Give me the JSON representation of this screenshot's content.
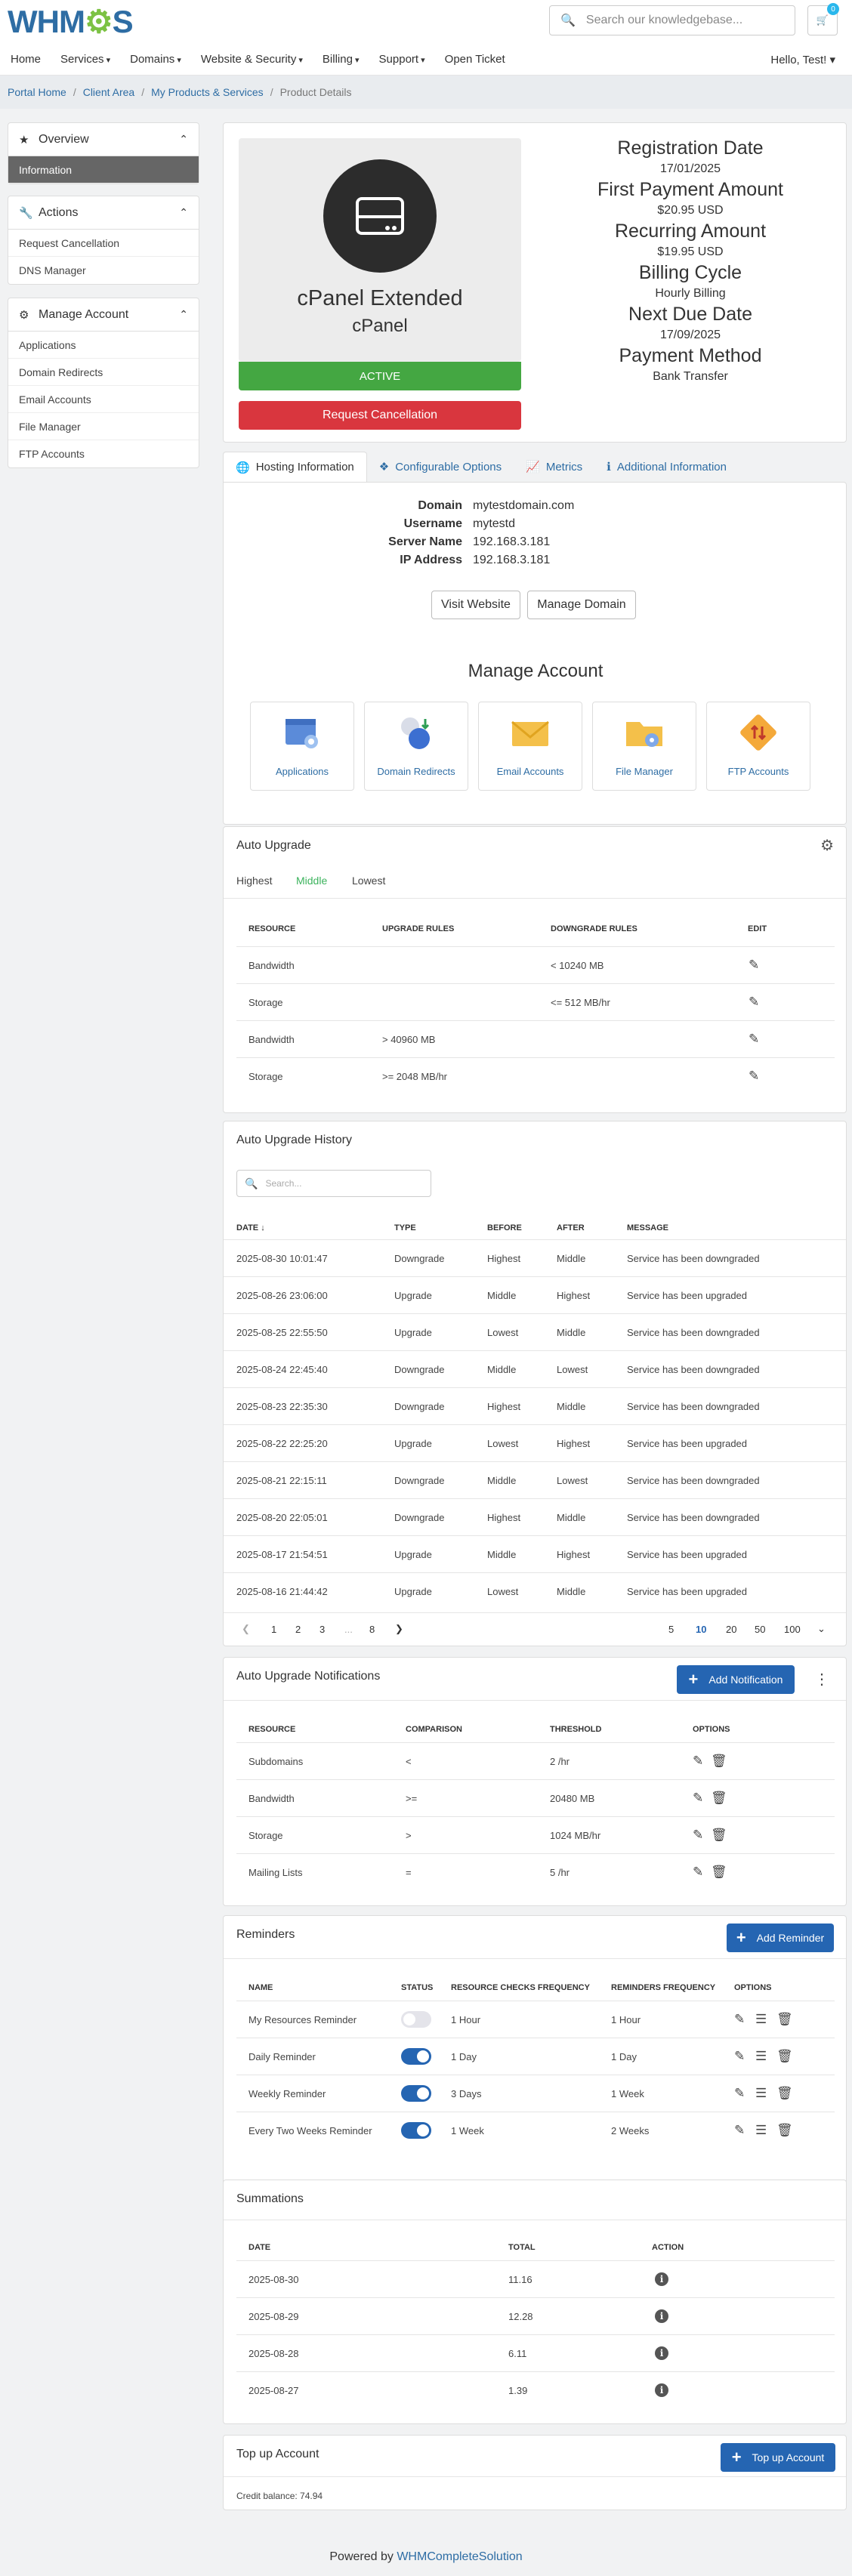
{
  "header": {
    "logo": "WHMCS",
    "search_placeholder": "Search our knowledgebase...",
    "cart_count": "0",
    "nav": [
      "Home",
      "Services",
      "Domains",
      "Website & Security",
      "Billing",
      "Support",
      "Open Ticket"
    ],
    "user_menu": "Hello, Test!"
  },
  "breadcrumb": [
    "Portal Home",
    "Client Area",
    "My Products & Services",
    "Product Details"
  ],
  "sidebar": {
    "overview": {
      "title": "Overview",
      "items": [
        "Information"
      ]
    },
    "actions": {
      "title": "Actions",
      "items": [
        "Request Cancellation",
        "DNS Manager"
      ]
    },
    "manage": {
      "title": "Manage Account",
      "items": [
        "Applications",
        "Domain Redirects",
        "Email Accounts",
        "File Manager",
        "FTP Accounts"
      ]
    }
  },
  "product": {
    "name": "cPanel Extended",
    "group": "cPanel",
    "status": "ACTIVE",
    "cancel_label": "Request Cancellation",
    "details": [
      {
        "label": "Registration Date",
        "value": "17/01/2025"
      },
      {
        "label": "First Payment Amount",
        "value": "$20.95 USD"
      },
      {
        "label": "Recurring Amount",
        "value": "$19.95 USD"
      },
      {
        "label": "Billing Cycle",
        "value": "Hourly Billing"
      },
      {
        "label": "Next Due Date",
        "value": "17/09/2025"
      },
      {
        "label": "Payment Method",
        "value": "Bank Transfer"
      }
    ]
  },
  "tabs": [
    "Hosting Information",
    "Configurable Options",
    "Metrics",
    "Additional Information"
  ],
  "hosting": {
    "fields": [
      {
        "k": "Domain",
        "v": "mytestdomain.com"
      },
      {
        "k": "Username",
        "v": "mytestd"
      },
      {
        "k": "Server Name",
        "v": "192.168.3.181"
      },
      {
        "k": "IP Address",
        "v": "192.168.3.181"
      }
    ],
    "visit_label": "Visit Website",
    "manage_domain_label": "Manage Domain",
    "manage_title": "Manage Account",
    "tiles": [
      "Applications",
      "Domain Redirects",
      "Email Accounts",
      "File Manager",
      "FTP Accounts"
    ]
  },
  "auto_upgrade": {
    "title": "Auto Upgrade",
    "levels": [
      "Highest",
      "Middle",
      "Lowest"
    ],
    "active_level": "Middle",
    "headers": [
      "Resource",
      "Upgrade Rules",
      "Downgrade Rules",
      "Edit"
    ],
    "rows": [
      {
        "resource": "Bandwidth",
        "up": "",
        "down": "< 10240 MB"
      },
      {
        "resource": "Storage",
        "up": "",
        "down": "<= 512 MB/hr"
      },
      {
        "resource": "Bandwidth",
        "up": "> 40960 MB",
        "down": ""
      },
      {
        "resource": "Storage",
        "up": ">= 2048 MB/hr",
        "down": ""
      }
    ]
  },
  "history": {
    "title": "Auto Upgrade History",
    "search_placeholder": "Search...",
    "headers": [
      "Date",
      "Type",
      "Before",
      "After",
      "Message"
    ],
    "sort_arrow": "↓",
    "rows": [
      {
        "date": "2025-08-30 10:01:47",
        "type": "Downgrade",
        "before": "Highest",
        "after": "Middle",
        "msg": "Service has been downgraded"
      },
      {
        "date": "2025-08-26 23:06:00",
        "type": "Upgrade",
        "before": "Middle",
        "after": "Highest",
        "msg": "Service has been upgraded"
      },
      {
        "date": "2025-08-25 22:55:50",
        "type": "Upgrade",
        "before": "Lowest",
        "after": "Middle",
        "msg": "Service has been downgraded"
      },
      {
        "date": "2025-08-24 22:45:40",
        "type": "Downgrade",
        "before": "Middle",
        "after": "Lowest",
        "msg": "Service has been downgraded"
      },
      {
        "date": "2025-08-23 22:35:30",
        "type": "Downgrade",
        "before": "Highest",
        "after": "Middle",
        "msg": "Service has been downgraded"
      },
      {
        "date": "2025-08-22 22:25:20",
        "type": "Upgrade",
        "before": "Lowest",
        "after": "Highest",
        "msg": "Service has been upgraded"
      },
      {
        "date": "2025-08-21 22:15:11",
        "type": "Downgrade",
        "before": "Middle",
        "after": "Lowest",
        "msg": "Service has been downgraded"
      },
      {
        "date": "2025-08-20 22:05:01",
        "type": "Downgrade",
        "before": "Highest",
        "after": "Middle",
        "msg": "Service has been downgraded"
      },
      {
        "date": "2025-08-17 21:54:51",
        "type": "Upgrade",
        "before": "Middle",
        "after": "Highest",
        "msg": "Service has been upgraded"
      },
      {
        "date": "2025-08-16 21:44:42",
        "type": "Upgrade",
        "before": "Lowest",
        "after": "Middle",
        "msg": "Service has been upgraded"
      }
    ],
    "pages": [
      "1",
      "2",
      "3",
      "...",
      "8"
    ],
    "page_sizes": [
      "5",
      "10",
      "20",
      "50",
      "100"
    ],
    "current_page_size": "10"
  },
  "notifications": {
    "title": "Auto Upgrade Notifications",
    "add_label": "Add Notification",
    "headers": [
      "Resource",
      "Comparison",
      "Threshold",
      "Options"
    ],
    "rows": [
      {
        "resource": "Subdomains",
        "cmp": "<",
        "threshold": "2 /hr"
      },
      {
        "resource": "Bandwidth",
        "cmp": ">=",
        "threshold": "20480 MB"
      },
      {
        "resource": "Storage",
        "cmp": ">",
        "threshold": "1024 MB/hr"
      },
      {
        "resource": "Mailing Lists",
        "cmp": "=",
        "threshold": "5 /hr"
      }
    ]
  },
  "reminders": {
    "title": "Reminders",
    "add_label": "Add Reminder",
    "headers": [
      "Name",
      "Status",
      "Resource Checks Frequency",
      "Reminders Frequency",
      "Options"
    ],
    "rows": [
      {
        "name": "My Resources Reminder",
        "on": false,
        "check": "1 Hour",
        "freq": "1 Hour"
      },
      {
        "name": "Daily Reminder",
        "on": true,
        "check": "1 Day",
        "freq": "1 Day"
      },
      {
        "name": "Weekly Reminder",
        "on": true,
        "check": "3 Days",
        "freq": "1 Week"
      },
      {
        "name": "Every Two Weeks Reminder",
        "on": true,
        "check": "1 Week",
        "freq": "2 Weeks"
      }
    ]
  },
  "summations": {
    "title": "Summations",
    "headers": [
      "Date",
      "Total",
      "Action"
    ],
    "rows": [
      {
        "date": "2025-08-30",
        "total": "11.16"
      },
      {
        "date": "2025-08-29",
        "total": "12.28"
      },
      {
        "date": "2025-08-28",
        "total": "6.11"
      },
      {
        "date": "2025-08-27",
        "total": "1.39"
      }
    ]
  },
  "topup": {
    "title": "Top up Account",
    "button_label": "Top up Account",
    "balance_label": "Credit balance: 74.94"
  },
  "footer": {
    "prefix": "Powered by",
    "link": "WHMCompleteSolution"
  },
  "colors": {
    "primary": "#2565b2",
    "link": "#2e6da4",
    "active": "#44a742",
    "danger": "#d9363e"
  }
}
